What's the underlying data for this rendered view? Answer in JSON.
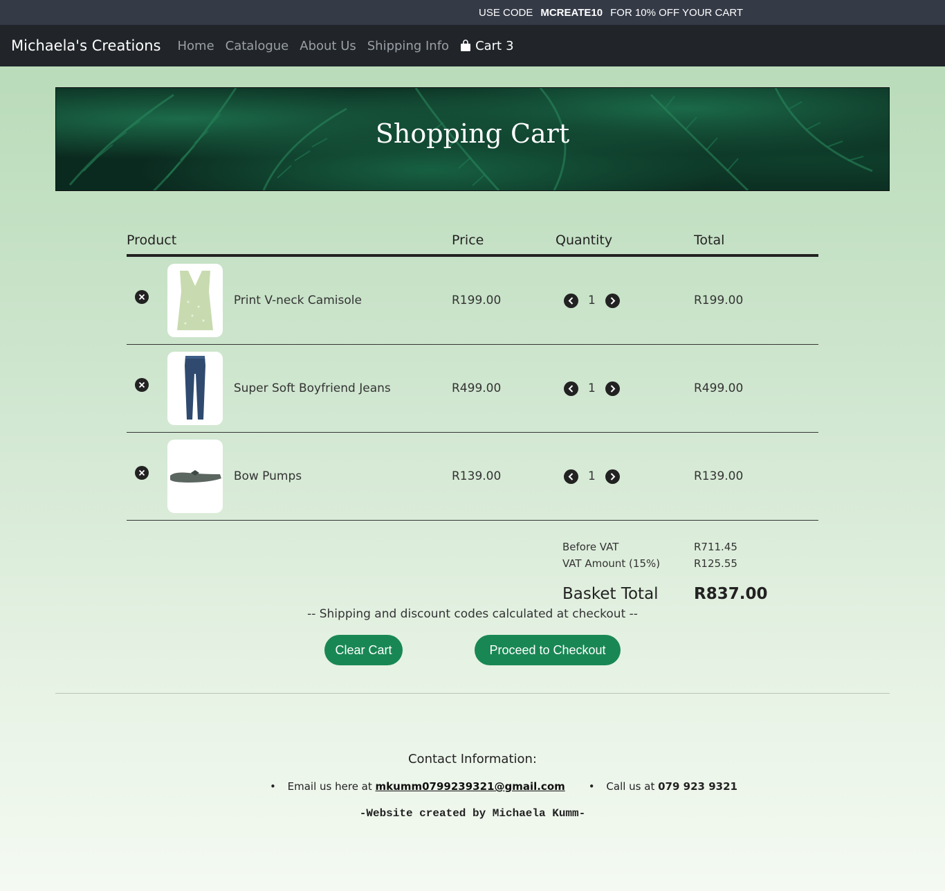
{
  "promo": {
    "prefix": "USE CODE",
    "code": "MCREATE10",
    "suffix": "FOR 10% OFF YOUR CART"
  },
  "nav": {
    "brand": "Michaela's Creations",
    "links": [
      "Home",
      "Catalogue",
      "About Us",
      "Shipping Info"
    ],
    "cart_label": "Cart",
    "cart_count": "3"
  },
  "hero": {
    "title": "Shopping Cart"
  },
  "table": {
    "headers": [
      "Product",
      "Price",
      "Quantity",
      "Total"
    ],
    "rows": [
      {
        "name": "Print V-neck Camisole",
        "price": "R199.00",
        "qty": "1",
        "total": "R199.00"
      },
      {
        "name": "Super Soft Boyfriend Jeans",
        "price": "R499.00",
        "qty": "1",
        "total": "R499.00"
      },
      {
        "name": "Bow Pumps",
        "price": "R139.00",
        "qty": "1",
        "total": "R139.00"
      }
    ]
  },
  "summary": {
    "before_vat_label": "Before VAT",
    "before_vat": "R711.45",
    "vat_label": "VAT Amount (15%)",
    "vat": "R125.55",
    "total_label": "Basket Total",
    "total": "R837.00"
  },
  "note": "-- Shipping and discount codes calculated at checkout --",
  "buttons": {
    "clear": "Clear Cart",
    "checkout": "Proceed to Checkout"
  },
  "footer": {
    "contact_title": "Contact Information:",
    "email_prefix": "Email us here at",
    "email": "mkumm0799239321@gmail.com",
    "phone_prefix": "Call us at",
    "phone": "079 923 9321",
    "credit": "-Website created by Michaela Kumm-"
  },
  "colors": {
    "accent": "#198754",
    "navbar": "#212529",
    "promo": "#343a46"
  }
}
